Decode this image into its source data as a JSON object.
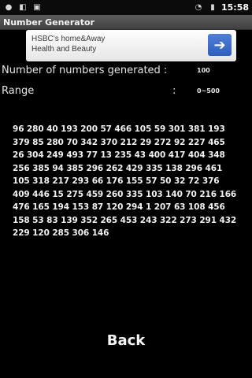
{
  "status_bar": {
    "time": "15:58",
    "icons": [
      {
        "name": "whatsapp-icon",
        "glyph": "●"
      },
      {
        "name": "notification-icon",
        "glyph": "◧"
      },
      {
        "name": "sd-card-icon",
        "glyph": "▣"
      },
      {
        "name": "wifi-icon",
        "glyph": "◔"
      },
      {
        "name": "battery-icon",
        "glyph": "▮"
      }
    ]
  },
  "title_bar": {
    "title": "Number Generator"
  },
  "ad": {
    "line1": "HSBC's home&Away",
    "line2": "Health and Beauty",
    "arrow": "➔"
  },
  "info": {
    "count_label": "Number of numbers generated :",
    "count_value": "100",
    "range_label": "Range",
    "range_colon": ":",
    "range_value": "0~500"
  },
  "numbers": {
    "text": "96 280 40 193 200 57 466 105 59 301 381 193 379 85 280 70 342 370 212 29 272 92 227 465 26 304 249 493 77 13 235 43 400 417 404 348 256 385 94 385 296 262 429 335 138 296 461 105 318 217 293 66 176 155 57 50 32 72 376 409 446 15 275 459 260 335 103 140 70 216 166 476 165 194 153 87 120 294 1 207 63 108 456 158 53 83 139 352 265 453 243 322 273 291 432 229 120 285 306 146"
  },
  "buttons": {
    "back_label": "Back"
  }
}
